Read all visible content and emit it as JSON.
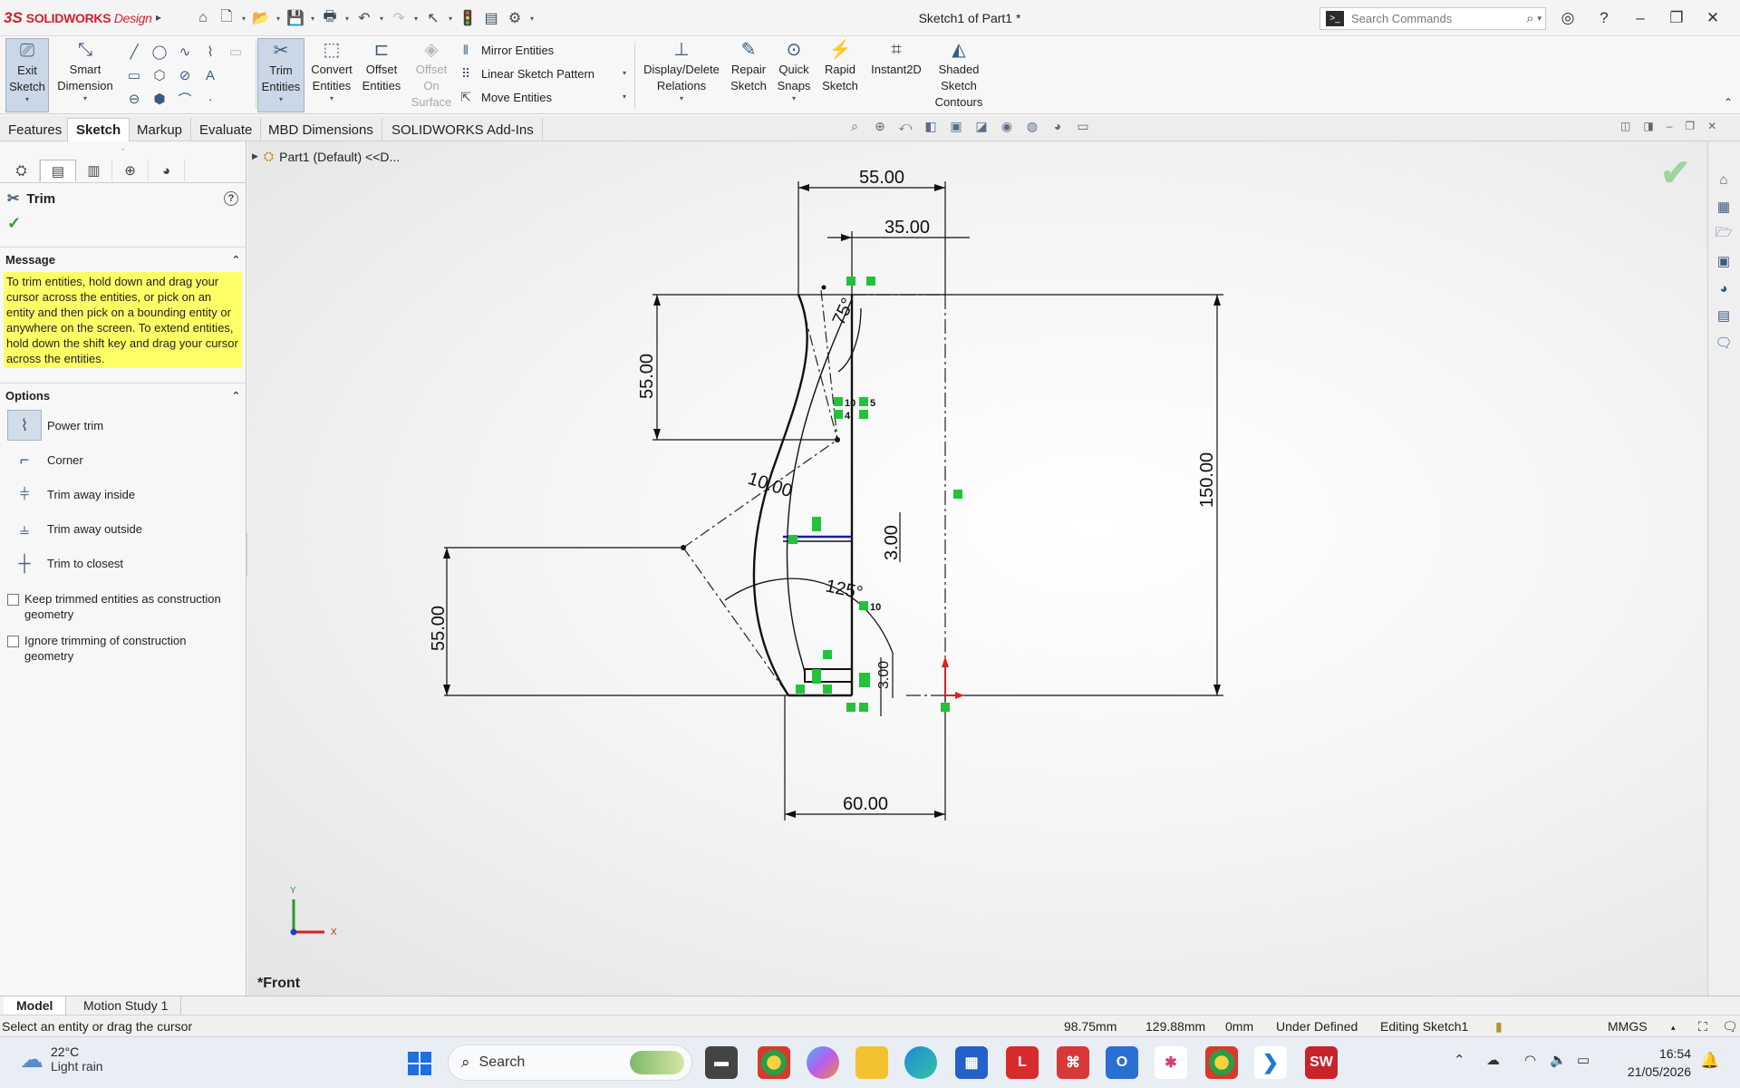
{
  "titlebar": {
    "brand_ds": "3S",
    "brand_text": "SOLIDWORKS",
    "brand_suffix": "Design",
    "document_title": "Sketch1 of Part1 *",
    "search_placeholder": "Search Commands"
  },
  "ribbon": {
    "exit_sketch": [
      "Exit",
      "Sketch"
    ],
    "smart_dimension": [
      "Smart",
      "Dimension"
    ],
    "trim_entities": [
      "Trim",
      "Entities"
    ],
    "convert_entities": [
      "Convert",
      "Entities"
    ],
    "offset_entities": [
      "Offset",
      "Entities"
    ],
    "offset_on_surface": [
      "Offset",
      "On",
      "Surface"
    ],
    "mirror_entities": "Mirror Entities",
    "linear_sketch_pattern": "Linear Sketch Pattern",
    "move_entities": "Move Entities",
    "display_delete_relations": [
      "Display/Delete",
      "Relations"
    ],
    "repair_sketch": [
      "Repair",
      "Sketch"
    ],
    "quick_snaps": [
      "Quick",
      "Snaps"
    ],
    "rapid_sketch": [
      "Rapid",
      "Sketch"
    ],
    "instant2d": "Instant2D",
    "shaded_sketch_contours": [
      "Shaded",
      "Sketch",
      "Contours"
    ]
  },
  "tabs": [
    "Features",
    "Sketch",
    "Markup",
    "Evaluate",
    "MBD Dimensions",
    "SOLIDWORKS Add-Ins"
  ],
  "active_tab": "Sketch",
  "property_manager": {
    "title": "Trim",
    "message_header": "Message",
    "message": "To trim entities, hold down and drag your cursor across the entities, or pick on an entity and then pick on a bounding entity or anywhere on the screen.  To extend entities, hold down the shift key and drag your cursor across the entities.",
    "options_header": "Options",
    "options": [
      "Power trim",
      "Corner",
      "Trim away inside",
      "Trim away outside",
      "Trim to closest"
    ],
    "checkbox_keep": "Keep trimmed entities as construction geometry",
    "checkbox_ignore": "Ignore trimming of construction geometry"
  },
  "graphics": {
    "tree_item": "Part1  (Default) <<D...",
    "view_label": "*Front",
    "dimensions": {
      "top_width": "55.00",
      "top_inner": "35.00",
      "upper_height": "55.00",
      "lower_height": "55.00",
      "total_height": "150.00",
      "bottom_width": "60.00",
      "angle_top": "75°",
      "angle_mid": "125°",
      "radius_small": "10.00",
      "slot_height": "3.00",
      "bottom_small": "3.00"
    },
    "relation_tags": [
      "10",
      "5",
      "4",
      "10"
    ],
    "axes": {
      "x": "X",
      "y": "Y"
    }
  },
  "bottom_tabs": [
    "Model",
    "Motion Study 1"
  ],
  "status": {
    "prompt": "Select an entity or drag the cursor",
    "x": "98.75mm",
    "y": "129.88mm",
    "z": "0mm",
    "definition": "Under Defined",
    "editing": "Editing Sketch1",
    "units": "MMGS"
  },
  "taskbar": {
    "temperature": "22°C",
    "weather": "Light rain",
    "search": "Search",
    "time": "16:54",
    "date": "21/05/2026"
  },
  "colors": {
    "brand_red": "#d4202a",
    "message_yellow": "#ffff66",
    "relation_green": "#22c33a",
    "origin_red": "#e02020"
  }
}
